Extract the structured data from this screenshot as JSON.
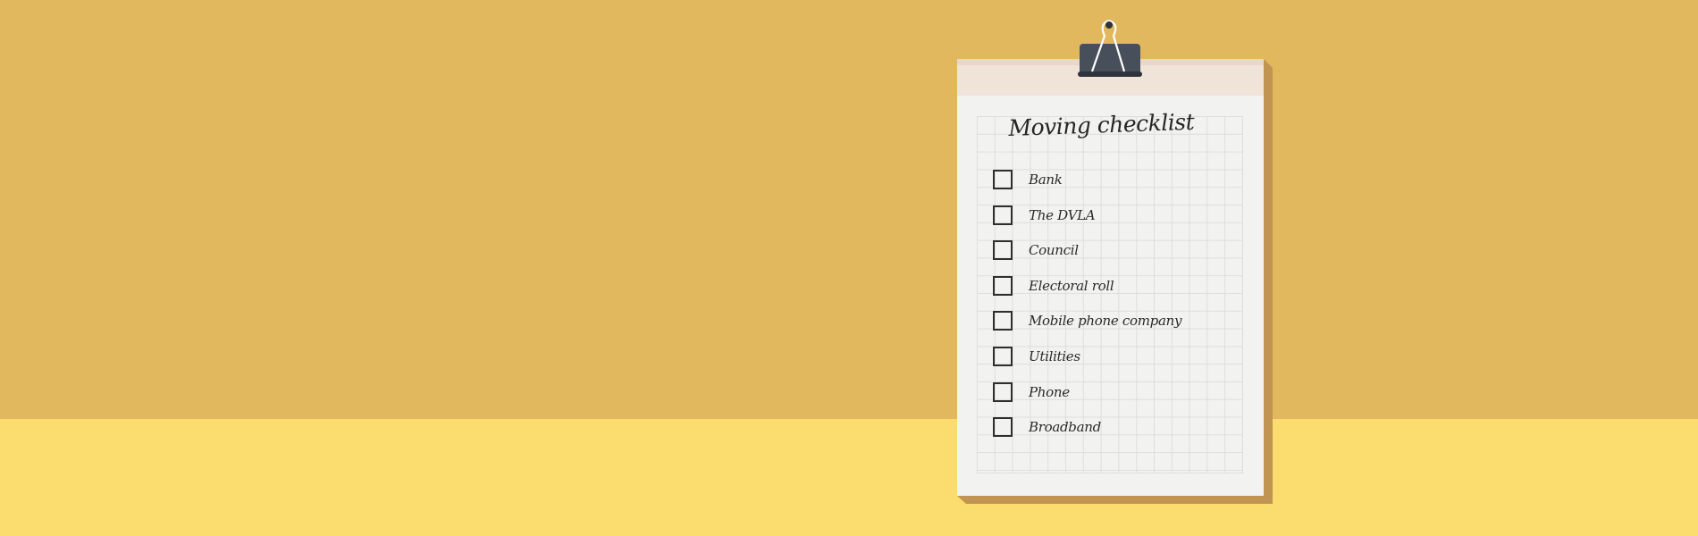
{
  "scene": {
    "description": "Illustration of a clipboard with a moving checklist on a desk against a wall",
    "colors": {
      "wall": "#E1B85E",
      "floor": "#FBDC6E",
      "paper": "#F2F2F1",
      "header_band": "#F0E3D8",
      "shadow": "#C19452",
      "clip_body": "#474F5B",
      "clip_bar": "#2E343D",
      "ink": "#262626"
    }
  },
  "checklist": {
    "title": "Moving checklist",
    "items": [
      {
        "label": "Bank",
        "checked": false
      },
      {
        "label": "The DVLA",
        "checked": false
      },
      {
        "label": "Council",
        "checked": false
      },
      {
        "label": "Electoral roll",
        "checked": false
      },
      {
        "label": "Mobile phone company",
        "checked": false
      },
      {
        "label": "Utilities",
        "checked": false
      },
      {
        "label": "Phone",
        "checked": false
      },
      {
        "label": "Broadband",
        "checked": false
      }
    ]
  }
}
